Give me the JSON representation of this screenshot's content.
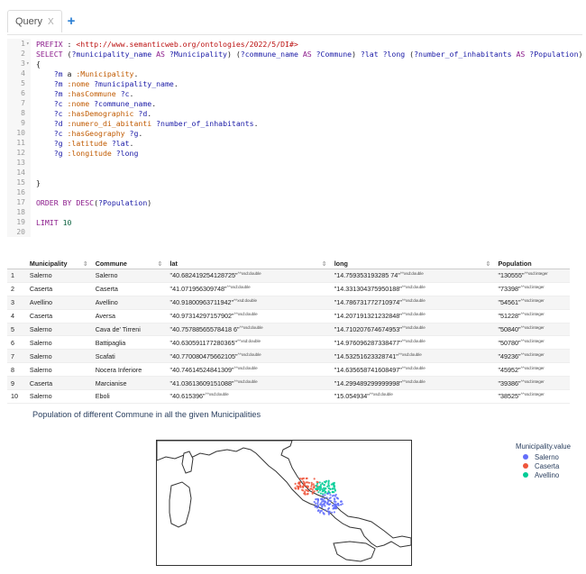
{
  "tab": {
    "label": "Query",
    "close": "X",
    "add": "+"
  },
  "editor": {
    "lines": [
      {
        "n": "1",
        "fold": "▾",
        "code": "<span class=\"kw\">PREFIX</span> : <span class=\"iri\">&lt;http://www.semanticweb.org/ontologies/2022/5/DI#&gt;</span>"
      },
      {
        "n": "2",
        "fold": "",
        "code": "<span class=\"kw\">SELECT</span> (<span class=\"var\">?municipality_name</span> <span class=\"kw\">AS</span> <span class=\"var\">?Municipality</span>) (<span class=\"var\">?commune_name</span> <span class=\"kw\">AS</span> <span class=\"var\">?Commune</span>) <span class=\"var\">?lat</span> <span class=\"var\">?long</span> (<span class=\"var\">?number_of_inhabitants</span> <span class=\"kw\">AS</span> <span class=\"var\">?Population</span>)"
      },
      {
        "n": "3",
        "fold": "▾",
        "code": "{"
      },
      {
        "n": "4",
        "fold": "",
        "code": "    <span class=\"var\">?m</span> a <span class=\"pfx\">:Municipality</span>."
      },
      {
        "n": "5",
        "fold": "",
        "code": "    <span class=\"var\">?m</span> <span class=\"pfx\">:nome</span> <span class=\"var\">?municipality_name</span>."
      },
      {
        "n": "6",
        "fold": "",
        "code": "    <span class=\"var\">?m</span> <span class=\"pfx\">:hasCommune</span> <span class=\"var\">?c</span>."
      },
      {
        "n": "7",
        "fold": "",
        "code": "    <span class=\"var\">?c</span> <span class=\"pfx\">:nome</span> <span class=\"var\">?commune_name</span>."
      },
      {
        "n": "8",
        "fold": "",
        "code": "    <span class=\"var\">?c</span> <span class=\"pfx\">:hasDemographic</span> <span class=\"var\">?d</span>."
      },
      {
        "n": "9",
        "fold": "",
        "code": "    <span class=\"var\">?d</span> <span class=\"pfx\">:numero_di_abitanti</span> <span class=\"var\">?number_of_inhabitants</span>."
      },
      {
        "n": "10",
        "fold": "",
        "code": "    <span class=\"var\">?c</span> <span class=\"pfx\">:hasGeography</span> <span class=\"var\">?g</span>."
      },
      {
        "n": "11",
        "fold": "",
        "code": "    <span class=\"var\">?g</span> <span class=\"pfx\">:latitude</span> <span class=\"var\">?lat</span>."
      },
      {
        "n": "12",
        "fold": "",
        "code": "    <span class=\"var\">?g</span> <span class=\"pfx\">:longitude</span> <span class=\"var\">?long</span>"
      },
      {
        "n": "13",
        "fold": "",
        "code": ""
      },
      {
        "n": "14",
        "fold": "",
        "code": ""
      },
      {
        "n": "15",
        "fold": "",
        "code": "}"
      },
      {
        "n": "16",
        "fold": "",
        "code": ""
      },
      {
        "n": "17",
        "fold": "",
        "code": "<span class=\"kw\">ORDER BY</span> <span class=\"kw\">DESC</span>(<span class=\"var\">?Population</span>)"
      },
      {
        "n": "18",
        "fold": "",
        "code": ""
      },
      {
        "n": "19",
        "fold": "",
        "code": "<span class=\"kw\">LIMIT</span> <span class=\"num\">10</span>"
      },
      {
        "n": "20",
        "fold": "",
        "code": ""
      }
    ]
  },
  "results": {
    "columns": [
      "",
      "Municipality",
      "Commune",
      "lat",
      "long",
      "Population"
    ],
    "sort_icon": "⇕",
    "double_type": "^^xsd:double",
    "int_type": "^^xsd:integer",
    "rows": [
      {
        "i": "1",
        "municipality": "Salerno",
        "commune": "Salerno",
        "lat": "\"40.682419254128725\"",
        "long": "\"14.759353193285 74\"",
        "pop": "\"130555\""
      },
      {
        "i": "2",
        "municipality": "Caserta",
        "commune": "Caserta",
        "lat": "\"41.071956309748\"",
        "long": "\"14.331304375950188\"",
        "pop": "\"73398\""
      },
      {
        "i": "3",
        "municipality": "Avellino",
        "commune": "Avellino",
        "lat": "\"40.91800963711942\"",
        "long": "\"14.786731772710974\"",
        "pop": "\"54561\""
      },
      {
        "i": "4",
        "municipality": "Caserta",
        "commune": "Aversa",
        "lat": "\"40.97314297157902\"",
        "long": "\"14.207191321232848\"",
        "pop": "\"51228\""
      },
      {
        "i": "5",
        "municipality": "Salerno",
        "commune": "Cava de' Tirreni",
        "lat": "\"40.75788565578418 6\"",
        "long": "\"14.710207674674953\"",
        "pop": "\"50840\""
      },
      {
        "i": "6",
        "municipality": "Salerno",
        "commune": "Battipaglia",
        "lat": "\"40.630591177280365\"",
        "long": "\"14.976096287338477\"",
        "pop": "\"50780\""
      },
      {
        "i": "7",
        "municipality": "Salerno",
        "commune": "Scafati",
        "lat": "\"40.770080475662105\"",
        "long": "\"14.53251623328741\"",
        "pop": "\"49236\""
      },
      {
        "i": "8",
        "municipality": "Salerno",
        "commune": "Nocera Inferiore",
        "lat": "\"40.74614524841309\"",
        "long": "\"14.635658741608497\"",
        "pop": "\"45952\""
      },
      {
        "i": "9",
        "municipality": "Caserta",
        "commune": "Marcianise",
        "lat": "\"41.03613609151088\"",
        "long": "\"14.299489299999998\"",
        "pop": "\"39386\""
      },
      {
        "i": "10",
        "municipality": "Salerno",
        "commune": "Eboli",
        "lat": "\"40.615396\"",
        "long": "\"15.054934\"",
        "pop": "\"38525\""
      }
    ]
  },
  "plot": {
    "title": "Population of different Commune in all the given Municipalities",
    "legend_title": "Municipality.value",
    "legend": [
      {
        "name": "Salerno",
        "color": "#636efa"
      },
      {
        "name": "Caserta",
        "color": "#ef553b"
      },
      {
        "name": "Avellino",
        "color": "#00cc96"
      }
    ]
  }
}
